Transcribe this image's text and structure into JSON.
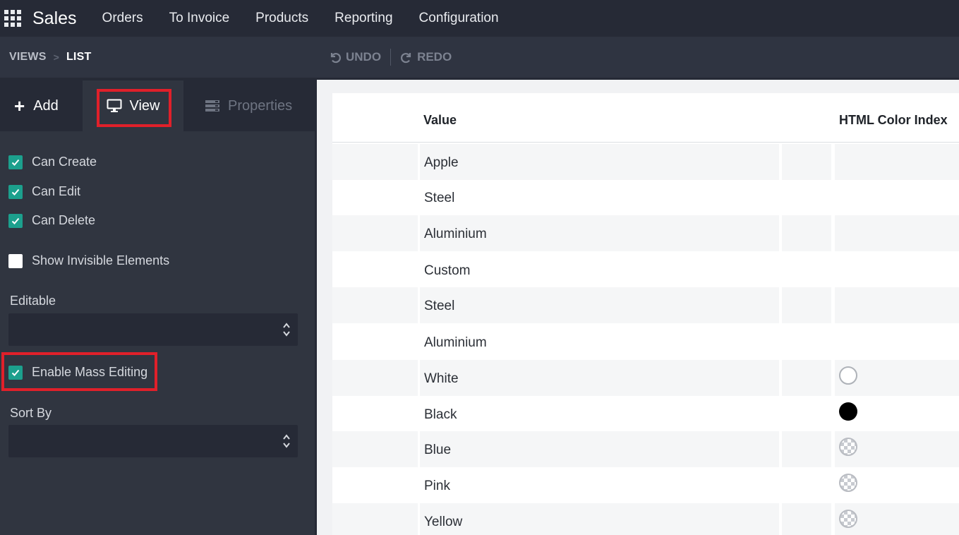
{
  "topbar": {
    "app_name": "Sales",
    "menu": [
      "Orders",
      "To Invoice",
      "Products",
      "Reporting",
      "Configuration"
    ]
  },
  "breadcrumb": {
    "views": "VIEWS",
    "separator": ">",
    "current": "LIST"
  },
  "history": {
    "undo": "UNDO",
    "redo": "REDO"
  },
  "sidebar": {
    "tabs": {
      "add": "Add",
      "view": "View",
      "properties": "Properties"
    },
    "checks": {
      "can_create": {
        "label": "Can Create",
        "checked": true
      },
      "can_edit": {
        "label": "Can Edit",
        "checked": true
      },
      "can_delete": {
        "label": "Can Delete",
        "checked": true
      },
      "show_invisible": {
        "label": "Show Invisible Elements",
        "checked": false
      },
      "mass_editing": {
        "label": "Enable Mass Editing",
        "checked": true
      }
    },
    "editable": {
      "label": "Editable",
      "value": ""
    },
    "sort_by": {
      "label": "Sort By",
      "value": ""
    }
  },
  "list": {
    "columns": {
      "value": "Value",
      "html_color": "HTML Color Index"
    },
    "rows": [
      {
        "value": "Apple",
        "color": ""
      },
      {
        "value": "Steel",
        "color": ""
      },
      {
        "value": "Aluminium",
        "color": ""
      },
      {
        "value": "Custom",
        "color": ""
      },
      {
        "value": "Steel",
        "color": ""
      },
      {
        "value": "Aluminium",
        "color": ""
      },
      {
        "value": "White",
        "color": "white"
      },
      {
        "value": "Black",
        "color": "black"
      },
      {
        "value": "Blue",
        "color": "unset"
      },
      {
        "value": "Pink",
        "color": "unset"
      },
      {
        "value": "Yellow",
        "color": "unset"
      }
    ]
  },
  "colors": {
    "accent_check": "#1ca08d",
    "highlight_box": "#e0202a",
    "nav_bg": "#262a36",
    "panel_bg": "#303540"
  }
}
